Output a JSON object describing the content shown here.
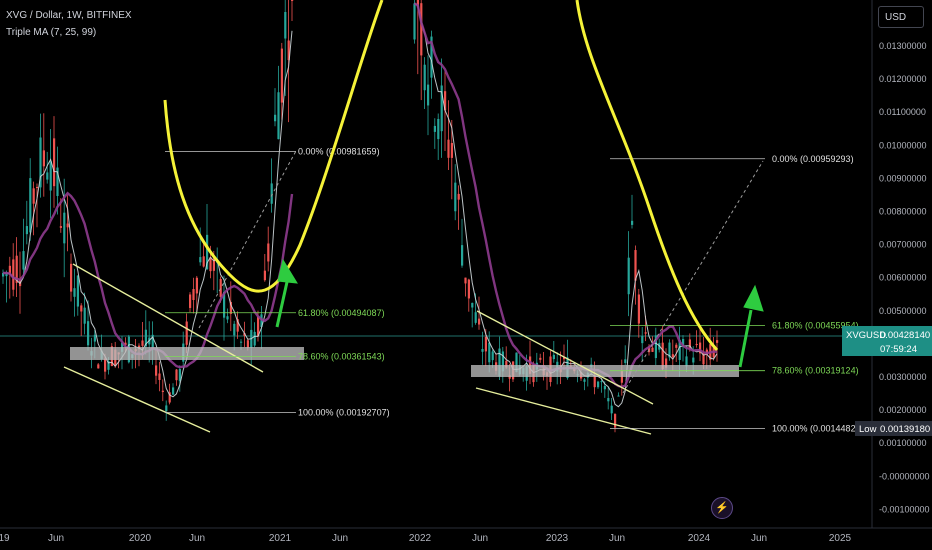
{
  "header": {
    "symbol_line": "XVG / Dollar, 1W, BITFINEX",
    "indicator_line": "Triple MA (7, 25, 99)",
    "currency_button": "USD"
  },
  "colors": {
    "background": "#000000",
    "up": "#26a69a",
    "down": "#ef5350",
    "ma_fast": "#cfd8dc",
    "ma_slow": "#8e3b8e",
    "yellow": "#f5f238",
    "arrow": "#2ecc40",
    "band": "#bdbdbd",
    "trend": "#e6ee9c",
    "badge_teal": "#1e8f85",
    "badge_low": "#2a2e39"
  },
  "chart_data": {
    "type": "candlestick",
    "series_name": "XVGUSD",
    "y_unit": "USD",
    "ylim": [
      -0.00115,
      0.0138
    ],
    "y_ticks": [
      "0.01300000",
      "0.01200000",
      "0.01100000",
      "0.01000000",
      "0.00900000",
      "0.00800000",
      "0.00700000",
      "0.00600000",
      "0.00500000",
      "0.00400000",
      "0.00300000",
      "0.00200000",
      "0.00100000",
      "-0.00000000",
      "-0.00100000"
    ],
    "x_ticks": [
      "19",
      "Jun",
      "2020",
      "Jun",
      "2021",
      "Jun",
      "2022",
      "Jun",
      "2023",
      "Jun",
      "2024",
      "Jun",
      "2025"
    ],
    "price_badge": {
      "label": "XVGUSD",
      "value": "0.00428140",
      "countdown": "07:59:24",
      "price": 0.0042814
    },
    "low_badge": {
      "label": "Low",
      "value": "0.00139180",
      "price": 0.0013918
    },
    "fib_levels": [
      {
        "label": "0.00% (0.00981659)",
        "value": 0.00981659,
        "group": 1
      },
      {
        "label": "61.80% (0.00494087)",
        "value": 0.00494087,
        "group": 1
      },
      {
        "label": "78.60% (0.00361543)",
        "value": 0.00361543,
        "group": 1
      },
      {
        "label": "100.00% (0.00192707)",
        "value": 0.00192707,
        "group": 1
      },
      {
        "label": "0.00% (0.00959293)",
        "value": 0.00959293,
        "group": 2
      },
      {
        "label": "61.80% (0.00455954)",
        "value": 0.00455954,
        "group": 2
      },
      {
        "label": "78.60% (0.00319124)",
        "value": 0.00319124,
        "group": 2
      },
      {
        "label": "100.00% (0.00144829)",
        "value": 0.00144829,
        "group": 2
      }
    ]
  }
}
